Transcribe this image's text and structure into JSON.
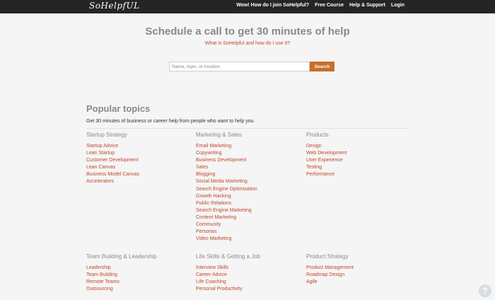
{
  "header": {
    "logo": "SoHelpfUL",
    "nav": [
      "Wow! How do I join SoHelpful?",
      "Free Course",
      "Help & Support",
      "Login"
    ]
  },
  "hero": {
    "title": "Schedule a call to get 30 minutes of help",
    "subtitle_link": "What is SoHelpful and how do I use it?"
  },
  "search": {
    "placeholder": "Name, topic, or location",
    "button": "Search"
  },
  "popular": {
    "title": "Popular topics",
    "subtitle": "Get 30 minutes of business or career help from people who want to help you.",
    "categories": [
      {
        "title": "Startup Strategy",
        "items": [
          "Startup Advice",
          "Lean Startup",
          "Customer Development",
          "Lean Canvas",
          "Business Model Canvas",
          "Accelerators"
        ]
      },
      {
        "title": "Marketing & Sales",
        "items": [
          "Email Marketing",
          "Copywriting",
          "Business Development",
          "Sales",
          "Blogging",
          "Social Media Marketing",
          "Search Engine Optimization",
          "Growth Hacking",
          "Public Relations",
          "Search Engine Marketing",
          "Content Marketing",
          "Community",
          "Personas",
          "Video Marketing"
        ]
      },
      {
        "title": "Products",
        "items": [
          "Design",
          "Web Development",
          "User Experience",
          "Testing",
          "Performance"
        ]
      },
      {
        "title": "Team Building & Leadership",
        "items": [
          "Leadership",
          "Team Building",
          "Remote Teams",
          "Outsourcing"
        ]
      },
      {
        "title": "Life Skills & Getting a Job",
        "items": [
          "Interview Skills",
          "Career Advice",
          "Life Coaching",
          "Personal Productivity"
        ]
      },
      {
        "title": "Product Strategy",
        "items": [
          "Product Management",
          "Roadmap Design",
          "Agile"
        ]
      }
    ]
  },
  "help_button": "?"
}
